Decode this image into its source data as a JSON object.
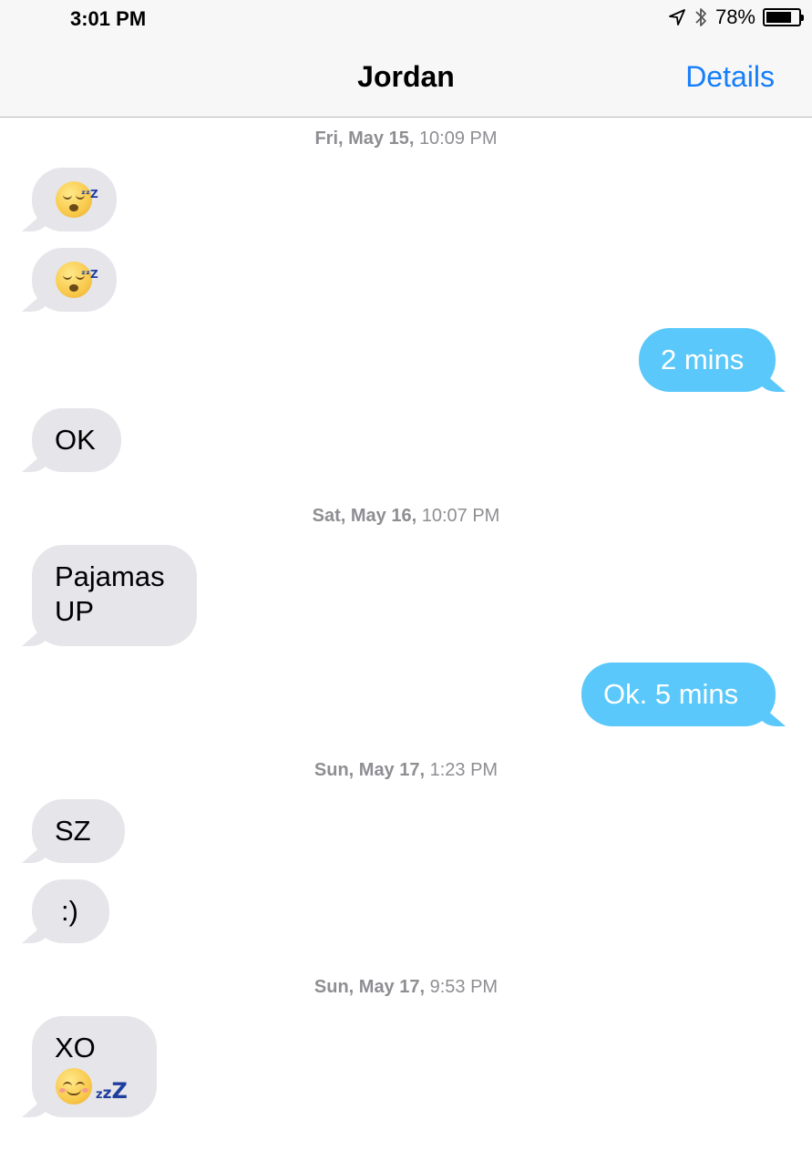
{
  "status_bar": {
    "time": "3:01 PM",
    "battery_text": "78%",
    "battery_level": 0.78,
    "icons": [
      "location-arrow-icon",
      "bluetooth-icon",
      "battery-icon"
    ]
  },
  "nav": {
    "title": "Jordan",
    "details_label": "Details"
  },
  "colors": {
    "incoming_bubble": "#e5e5ea",
    "outgoing_bubble": "#5ac8fa",
    "link": "#147efb",
    "timestamp": "#8e8e93"
  },
  "timestamps": [
    {
      "day": "Fri, May 15,",
      "time": "10:09 PM"
    },
    {
      "day": "Sat, May 16,",
      "time": "10:07 PM"
    },
    {
      "day": "Sun, May 17,",
      "time": "1:23 PM"
    },
    {
      "day": "Sun, May 17,",
      "time": "9:53 PM"
    }
  ],
  "messages": [
    {
      "direction": "incoming",
      "emoji": "sleeping-face"
    },
    {
      "direction": "incoming",
      "emoji": "sleeping-face"
    },
    {
      "direction": "outgoing",
      "text": "2 mins"
    },
    {
      "direction": "incoming",
      "text": "OK"
    },
    {
      "direction": "incoming",
      "text": "Pajamas\nUP"
    },
    {
      "direction": "outgoing",
      "text": "Ok. 5 mins"
    },
    {
      "direction": "incoming",
      "text": "SZ"
    },
    {
      "direction": "incoming",
      "text": ":)"
    },
    {
      "direction": "incoming",
      "text": "XO",
      "emoji": "smiling-face-with-zzz"
    }
  ]
}
